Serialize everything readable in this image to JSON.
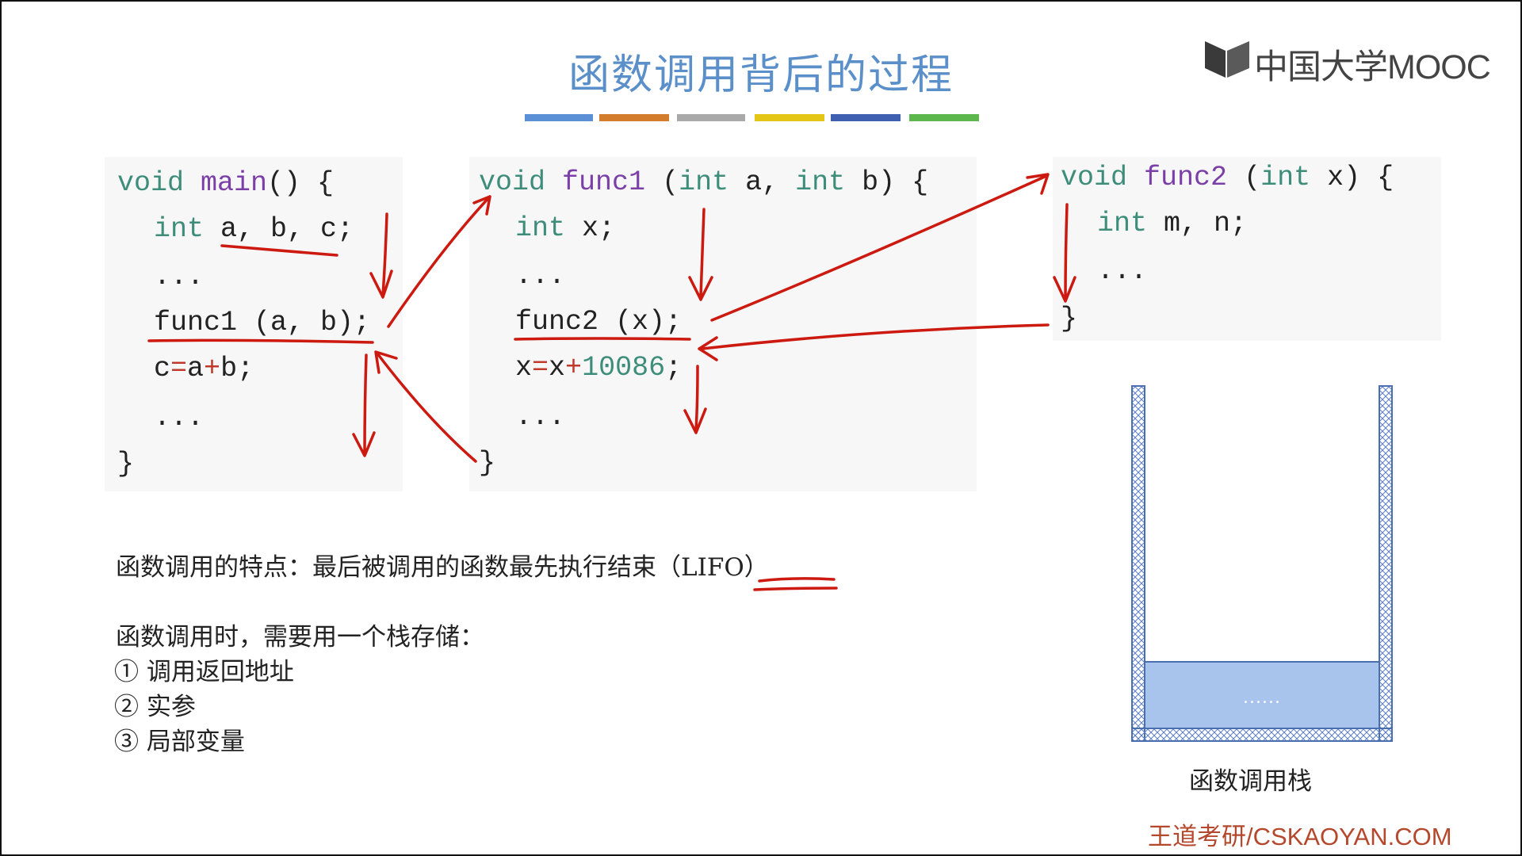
{
  "slide": {
    "title": "函数调用背后的过程",
    "logo_text": "中国大学MOOC",
    "footer": "王道考研/CSKAOYAN.COM"
  },
  "palette": {
    "title": "#5b8fc9",
    "bar_colors": [
      "#5b8fd6",
      "#d37c2c",
      "#a9a9a9",
      "#e3c616",
      "#3f5fb0",
      "#5cb84d"
    ],
    "annotation": "#cc1a10",
    "stack_fill": "#a8c4ec"
  },
  "code": {
    "main": {
      "l1_kw": "void",
      "l1_name": "main",
      "l1_rest": "() {",
      "l2_kw": "int",
      "l2_rest": " a, b, c;",
      "l3": "...",
      "l4": "func1 (a, b);",
      "l5_a": "c",
      "l5_b": "=",
      "l5_c": "a",
      "l5_d": "+",
      "l5_e": "b;",
      "l6": "...",
      "l7": "}"
    },
    "func1": {
      "l1_kw": "void",
      "l1_name": "func1",
      "l1_p1": " (",
      "l1_int1": "int",
      "l1_p2": " a, ",
      "l1_int2": "int",
      "l1_p3": " b) {",
      "l2_kw": "int",
      "l2_rest": " x;",
      "l3": "...",
      "l4": "func2 (x);",
      "l5_a": "x",
      "l5_b": "=",
      "l5_c": "x",
      "l5_d": "+",
      "l5_e": "10086",
      "l5_f": ";",
      "l6": "...",
      "l7": "}"
    },
    "func2": {
      "l1_kw": "void",
      "l1_name": "func2",
      "l1_p1": " (",
      "l1_int": "int",
      "l1_p2": " x) {",
      "l2_kw": "int",
      "l2_rest": " m, n;",
      "l3": "...",
      "l4": "}"
    }
  },
  "notes": {
    "feature": "函数调用的特点：最后被调用的函数最先执行结束（LIFO）",
    "storage_intro": "函数调用时，需要用一个栈存储：",
    "items": [
      "① 调用返回地址",
      "② 实参",
      "③ 局部变量"
    ]
  },
  "stack": {
    "content": "......",
    "label": "函数调用栈"
  }
}
